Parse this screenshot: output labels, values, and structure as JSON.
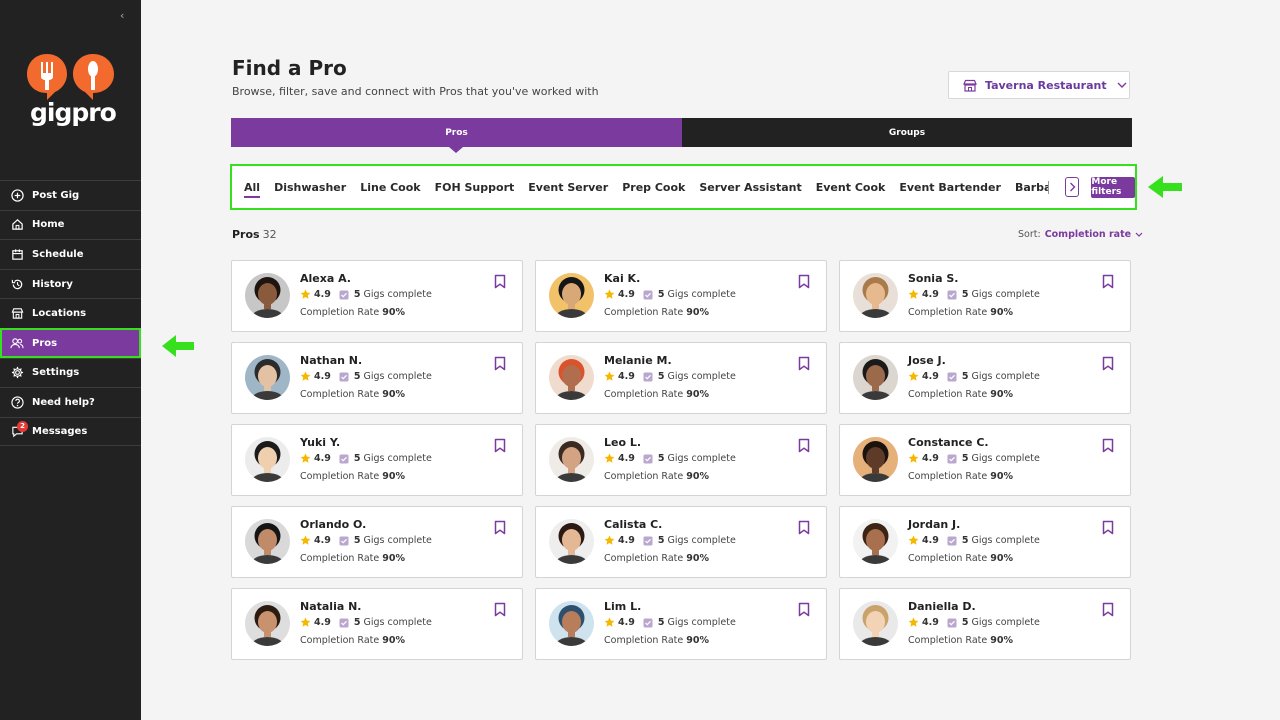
{
  "app": {
    "logo_text": "gigpro"
  },
  "sidebar": {
    "items": [
      {
        "label": "Post Gig",
        "icon": "plus-circle-icon"
      },
      {
        "label": "Home",
        "icon": "home-icon"
      },
      {
        "label": "Schedule",
        "icon": "calendar-icon"
      },
      {
        "label": "History",
        "icon": "history-icon"
      },
      {
        "label": "Locations",
        "icon": "store-icon"
      },
      {
        "label": "Pros",
        "icon": "users-icon"
      },
      {
        "label": "Settings",
        "icon": "gear-icon"
      },
      {
        "label": "Need help?",
        "icon": "question-icon"
      },
      {
        "label": "Messages",
        "icon": "chat-icon",
        "badge": "2"
      }
    ]
  },
  "header": {
    "title": "Find a Pro",
    "subtitle": "Browse, filter, save and connect with Pros that you've worked with",
    "restaurant": "Taverna Restaurant"
  },
  "tabs": {
    "pros": "Pros",
    "groups": "Groups"
  },
  "filters": {
    "chips": [
      "All",
      "Dishwasher",
      "Line Cook",
      "FOH Support",
      "Event Server",
      "Prep Cook",
      "Server Assistant",
      "Event Cook",
      "Event Bartender",
      "Barback"
    ],
    "more_label": "More filters"
  },
  "list": {
    "label": "Pros",
    "count": "32",
    "sort_label": "Sort:",
    "sort_value": "Completion rate"
  },
  "pros": [
    {
      "name": "Alexa A.",
      "rating": "4.9",
      "gigs": "5",
      "gigs_label": "Gigs complete",
      "rate_label": "Completion Rate",
      "rate": "90%"
    },
    {
      "name": "Kai K.",
      "rating": "4.9",
      "gigs": "5",
      "gigs_label": "Gigs complete",
      "rate_label": "Completion Rate",
      "rate": "90%"
    },
    {
      "name": "Sonia S.",
      "rating": "4.9",
      "gigs": "5",
      "gigs_label": "Gigs complete",
      "rate_label": "Completion Rate",
      "rate": "90%"
    },
    {
      "name": "Nathan N.",
      "rating": "4.9",
      "gigs": "5",
      "gigs_label": "Gigs complete",
      "rate_label": "Completion Rate",
      "rate": "90%"
    },
    {
      "name": "Melanie M.",
      "rating": "4.9",
      "gigs": "5",
      "gigs_label": "Gigs complete",
      "rate_label": "Completion Rate",
      "rate": "90%"
    },
    {
      "name": "Jose J.",
      "rating": "4.9",
      "gigs": "5",
      "gigs_label": "Gigs complete",
      "rate_label": "Completion Rate",
      "rate": "90%"
    },
    {
      "name": "Yuki Y.",
      "rating": "4.9",
      "gigs": "5",
      "gigs_label": "Gigs complete",
      "rate_label": "Completion Rate",
      "rate": "90%"
    },
    {
      "name": "Leo L.",
      "rating": "4.9",
      "gigs": "5",
      "gigs_label": "Gigs complete",
      "rate_label": "Completion Rate",
      "rate": "90%"
    },
    {
      "name": "Constance C.",
      "rating": "4.9",
      "gigs": "5",
      "gigs_label": "Gigs complete",
      "rate_label": "Completion Rate",
      "rate": "90%"
    },
    {
      "name": "Orlando O.",
      "rating": "4.9",
      "gigs": "5",
      "gigs_label": "Gigs complete",
      "rate_label": "Completion Rate",
      "rate": "90%"
    },
    {
      "name": "Calista C.",
      "rating": "4.9",
      "gigs": "5",
      "gigs_label": "Gigs complete",
      "rate_label": "Completion Rate",
      "rate": "90%"
    },
    {
      "name": "Jordan J.",
      "rating": "4.9",
      "gigs": "5",
      "gigs_label": "Gigs complete",
      "rate_label": "Completion Rate",
      "rate": "90%"
    },
    {
      "name": "Natalia N.",
      "rating": "4.9",
      "gigs": "5",
      "gigs_label": "Gigs complete",
      "rate_label": "Completion Rate",
      "rate": "90%"
    },
    {
      "name": "Lim L.",
      "rating": "4.9",
      "gigs": "5",
      "gigs_label": "Gigs complete",
      "rate_label": "Completion Rate",
      "rate": "90%"
    },
    {
      "name": "Daniella D.",
      "rating": "4.9",
      "gigs": "5",
      "gigs_label": "Gigs complete",
      "rate_label": "Completion Rate",
      "rate": "90%"
    }
  ],
  "colors": {
    "accent": "#7a3a9e",
    "sidebar": "#222222",
    "highlight": "#37e01c",
    "logo": "#f26a2e",
    "star": "#f5b800"
  }
}
